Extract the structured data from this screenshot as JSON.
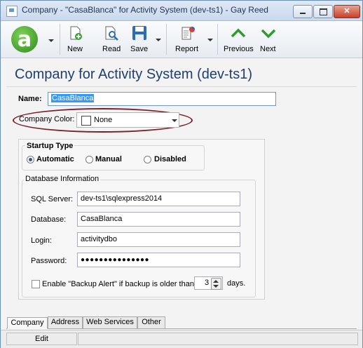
{
  "window": {
    "title": "Company - \"CasaBlanca\" for Activity System (dev-ts1) - Gay Reed",
    "minimize_glyph": "",
    "maximize_glyph": "",
    "close_glyph": "✕"
  },
  "toolbar": {
    "logo_letter": "a",
    "new_label": "New",
    "read_label": "Read",
    "save_label": "Save",
    "report_label": "Report",
    "previous_label": "Previous",
    "next_label": "Next",
    "accent_green": "#2f8a1c",
    "icons": [
      "app-logo-icon",
      "new-document-icon",
      "read-icon",
      "save-disk-icon",
      "report-icon",
      "up-chevron-icon",
      "down-chevron-icon"
    ]
  },
  "header": {
    "title": "Company for Activity System (dev-ts1)"
  },
  "form": {
    "name_label": "Name",
    "name_value": "CasaBlanca",
    "color_label": "Company Color:",
    "color_value": "None",
    "highlight_color": "#7a1f28"
  },
  "startup": {
    "title": "Startup Type",
    "options": [
      "Automatic",
      "Manual",
      "Disabled"
    ],
    "selected": "Automatic"
  },
  "database": {
    "title": "Database Information",
    "server_label": "SQL Server:",
    "server_value": "dev-ts1\\sqlexpress2014",
    "database_label": "Database:",
    "database_value": "CasaBlanca",
    "login_label": "Login:",
    "login_value": "activitydbo",
    "password_label": "Password:",
    "password_value": "●●●●●●●●●●●●●●●",
    "backup_label": "Enable \"Backup Alert\" if backup is older than",
    "backup_days": "3",
    "days_label": "days."
  },
  "tabs": [
    "Company",
    "Address",
    "Web Services",
    "Other"
  ],
  "status": {
    "mode": "Edit"
  }
}
